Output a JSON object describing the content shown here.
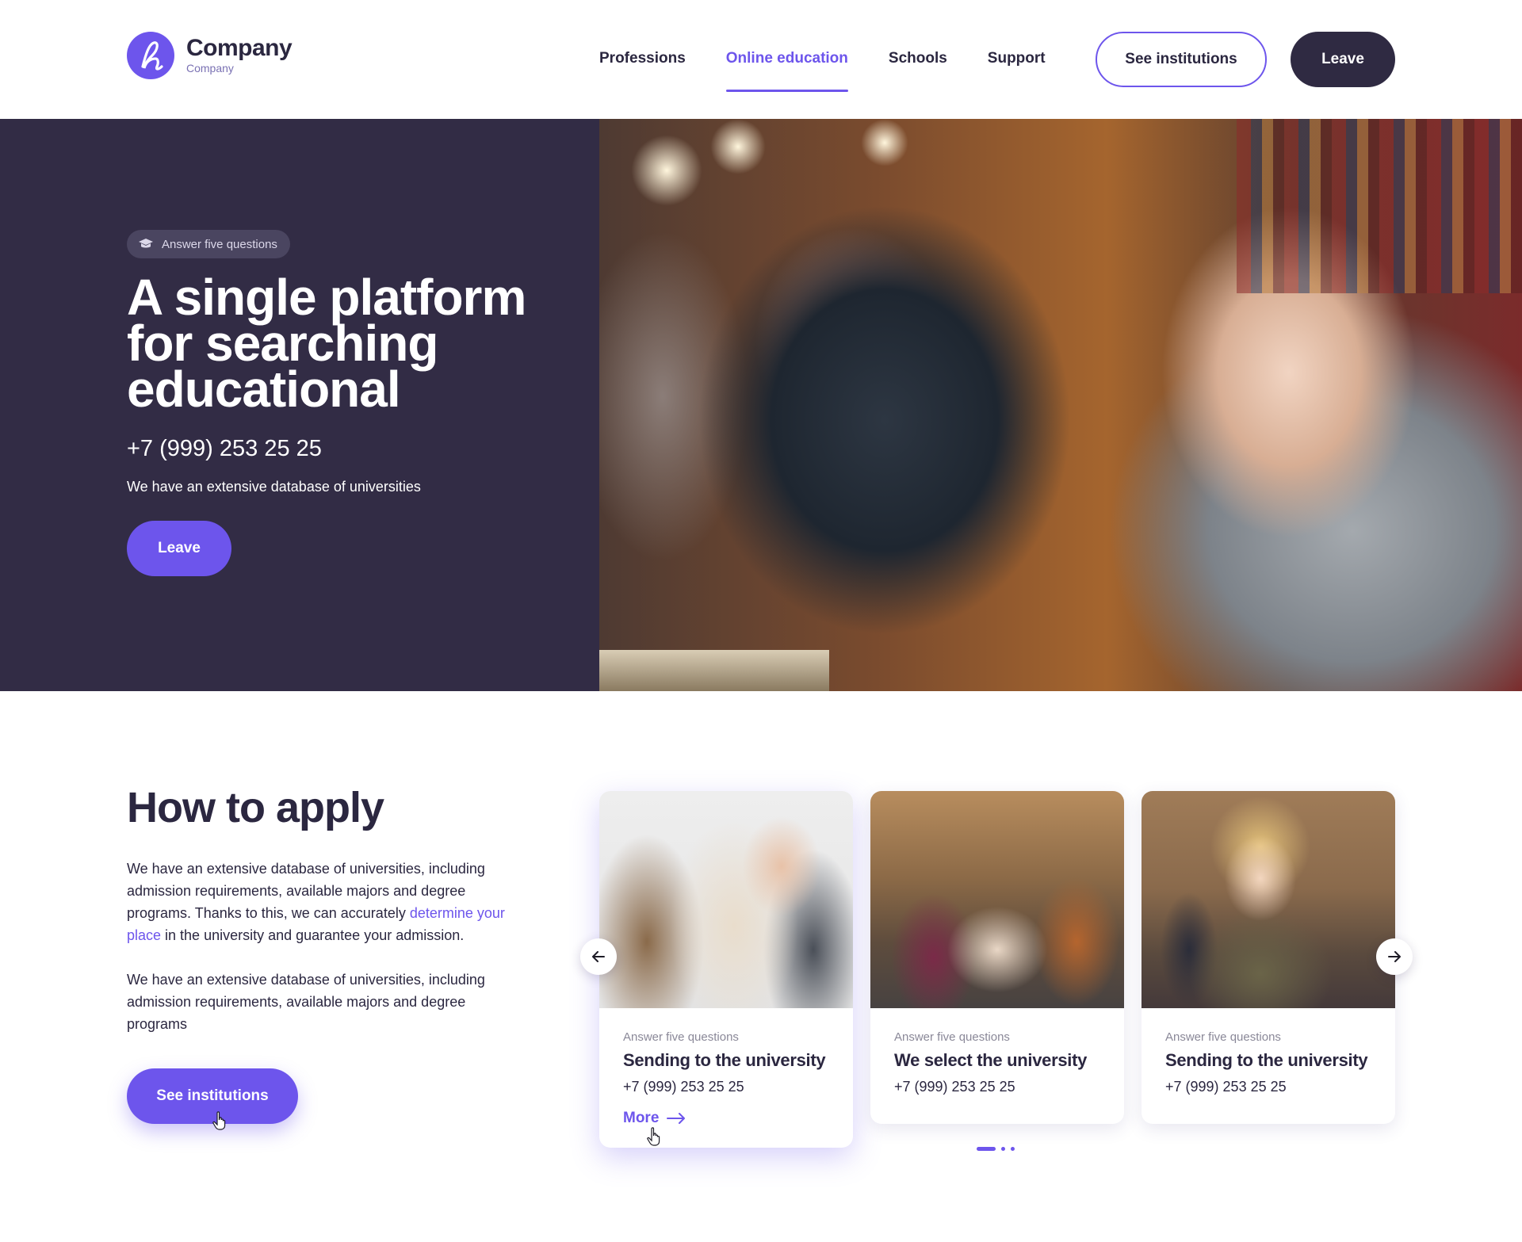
{
  "header": {
    "logo_title": "Company",
    "logo_subtitle": "Company",
    "nav": [
      {
        "label": "Professions",
        "active": false
      },
      {
        "label": "Online education",
        "active": true
      },
      {
        "label": "Schools",
        "active": false
      },
      {
        "label": "Support",
        "active": false
      }
    ],
    "see_institutions_label": "See institutions",
    "leave_label": "Leave"
  },
  "hero": {
    "badge": "Answer five questions",
    "title": "A single platform for searching educational",
    "phone": "+7 (999) 253 25 25",
    "description": "We have an extensive database of universities",
    "leave_label": "Leave"
  },
  "apply": {
    "title": "How to apply",
    "p1_before": "We have an extensive database of universities, including admission requirements, available majors and degree programs. Thanks to this, we can accurately ",
    "p1_link": "determine your place",
    "p1_after": " in the university and guarantee your admission.",
    "p2": "We have an extensive database of universities, including admission requirements, available majors and degree programs",
    "button_label": "See institutions"
  },
  "cards": [
    {
      "kicker": "Answer five questions",
      "title": "Sending to the university",
      "phone": "+7 (999) 253 25 25",
      "more": "More"
    },
    {
      "kicker": "Answer five questions",
      "title": "We select  the university",
      "phone": "+7 (999) 253 25 25"
    },
    {
      "kicker": "Answer five questions",
      "title": "Sending to the university",
      "phone": "+7 (999) 253 25 25"
    }
  ],
  "carousel": {
    "active_page": 1,
    "page_count": 3
  },
  "colors": {
    "accent": "#6d55ec",
    "dark": "#322c45",
    "text": "#2b2740"
  },
  "icons": [
    "logo-mark-icon",
    "graduation-cap-icon",
    "arrow-left-icon",
    "arrow-right-icon",
    "arrow-right-small-icon",
    "hand-cursor-icon"
  ]
}
